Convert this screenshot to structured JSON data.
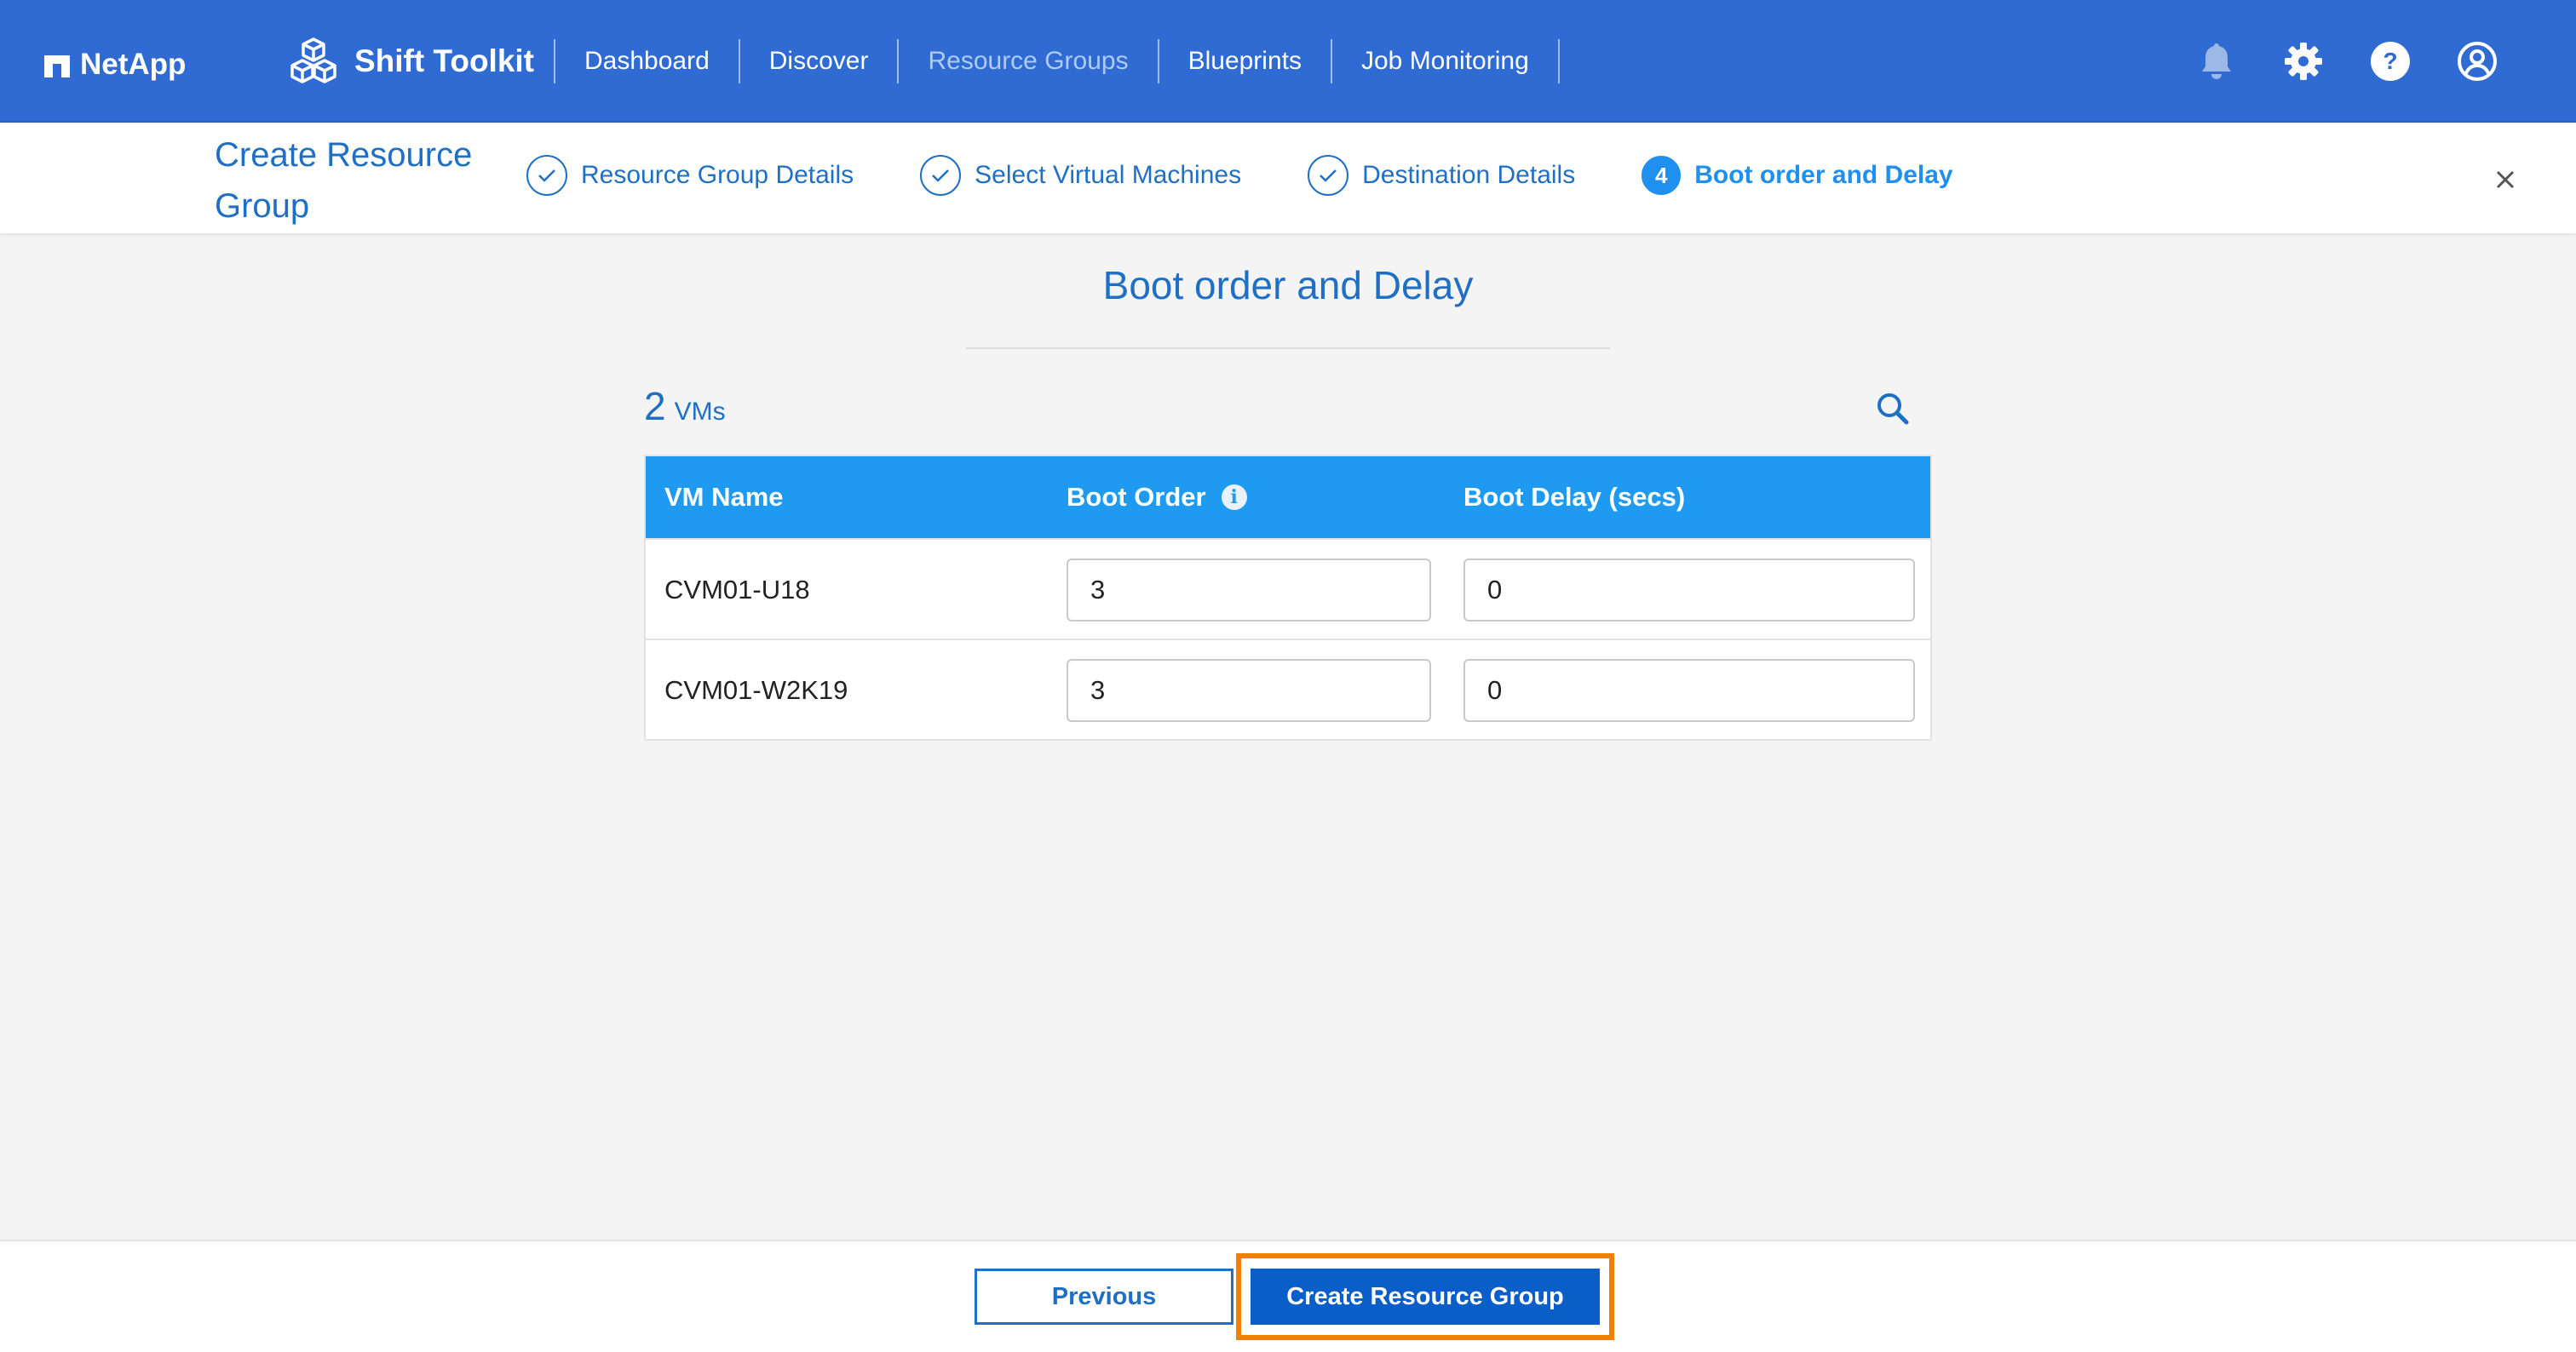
{
  "nav": {
    "brand": "NetApp",
    "product": "Shift Toolkit",
    "links": [
      {
        "label": "Dashboard",
        "active": false
      },
      {
        "label": "Discover",
        "active": false
      },
      {
        "label": "Resource Groups",
        "active": true
      },
      {
        "label": "Blueprints",
        "active": false
      },
      {
        "label": "Job Monitoring",
        "active": false
      }
    ],
    "icons": [
      "bell-icon",
      "gear-icon",
      "help-icon",
      "user-icon"
    ]
  },
  "wizard": {
    "title": "Create Resource Group",
    "steps": [
      {
        "label": "Resource Group Details",
        "state": "done"
      },
      {
        "label": "Select Virtual Machines",
        "state": "done"
      },
      {
        "label": "Destination Details",
        "state": "done"
      },
      {
        "label": "Boot order and Delay",
        "state": "current",
        "number": "4"
      }
    ]
  },
  "main": {
    "heading": "Boot order and Delay",
    "vm_count": "2",
    "vm_unit": "VMs",
    "table": {
      "headers": [
        "VM Name",
        "Boot Order",
        "Boot Delay (secs)"
      ],
      "rows": [
        {
          "name": "CVM01-U18",
          "boot_order": "3",
          "boot_delay": "0"
        },
        {
          "name": "CVM01-W2K19",
          "boot_order": "3",
          "boot_delay": "0"
        }
      ]
    }
  },
  "footer": {
    "previous_label": "Previous",
    "create_label": "Create Resource Group"
  },
  "colors": {
    "nav_bg": "#2f6bd3",
    "accent": "#1f6fc4",
    "table_header": "#1e9bf0",
    "primary_button": "#0a5ec8",
    "highlight": "#f0800a"
  }
}
